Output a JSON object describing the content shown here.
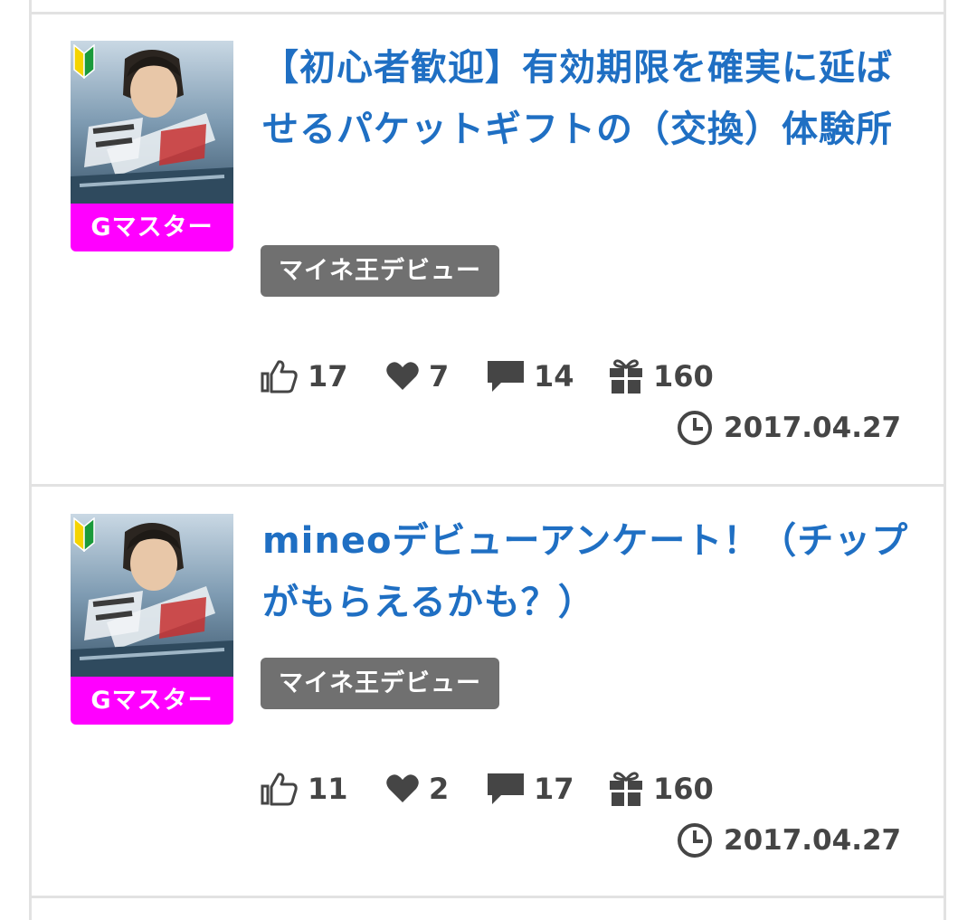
{
  "posts": [
    {
      "title": "【初心者歓迎】有効期限を確実に延ばせるパケットギフトの（交換）体験所",
      "rank": "Gマスター",
      "tag": "マイネ王デビュー",
      "likes": "17",
      "hearts": "7",
      "comments": "14",
      "gifts": "160",
      "date": "2017.04.27"
    },
    {
      "title": "mineoデビューアンケート！（チップがもらえるかも？）",
      "rank": "Gマスター",
      "tag": "マイネ王デビュー",
      "likes": "11",
      "hearts": "2",
      "comments": "17",
      "gifts": "160",
      "date": "2017.04.27"
    }
  ],
  "colors": {
    "title": "#1f6fc3",
    "rank_badge": "#ff00ff",
    "tag": "#707070",
    "stat_text": "#454545",
    "divider": "#e2e2e2"
  },
  "icons": [
    "beginner-mark-icon",
    "thumbs-up-icon",
    "heart-icon",
    "comment-icon",
    "gift-icon",
    "clock-icon"
  ]
}
